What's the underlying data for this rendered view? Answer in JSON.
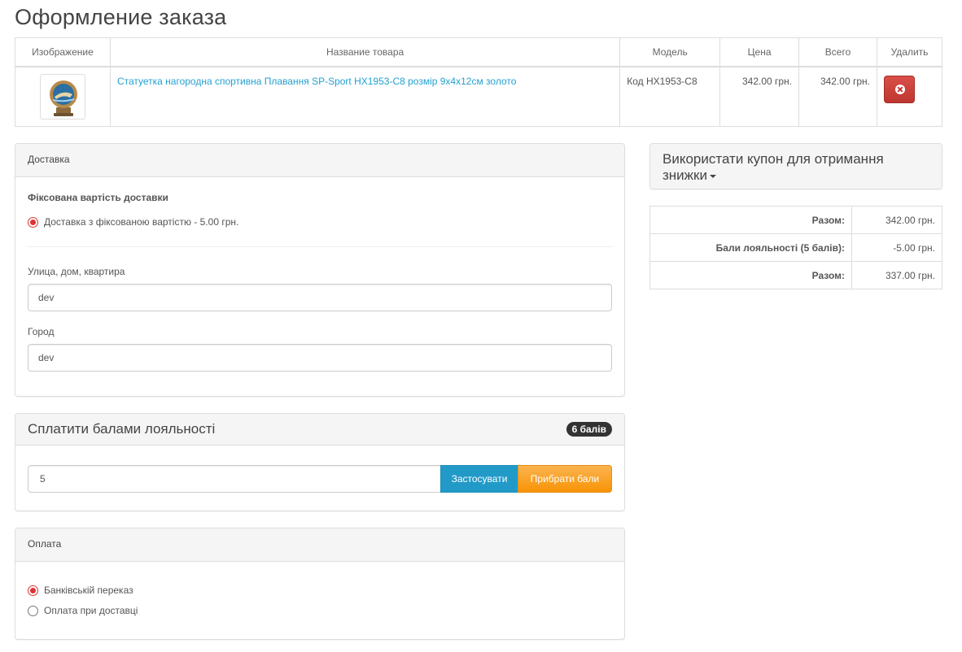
{
  "page": {
    "title": "Оформление заказа"
  },
  "cart": {
    "headers": [
      "Изображение",
      "Название товара",
      "Модель",
      "Цена",
      "Всего",
      "Удалить"
    ],
    "rows": [
      {
        "name": "Статуетка нагородна спортивна Плавання SP-Sport HX1953-C8 розмір 9х4х12см золото",
        "model": "Код HX1953-C8",
        "price": "342.00 грн.",
        "total": "342.00 грн."
      }
    ]
  },
  "delivery": {
    "heading": "Доставка",
    "method_title": "Фіксована вартість доставки",
    "option_label": "Доставка з фіксованою вартістю - 5.00 грн.",
    "street_label": "Улица, дом, квартира",
    "street_value": "dev",
    "city_label": "Город",
    "city_value": "dev"
  },
  "loyalty": {
    "heading": "Сплатити балами лояльності",
    "badge": "6 балів",
    "points_value": "5",
    "apply_label": "Застосувати",
    "remove_label": "Прибрати бали"
  },
  "payment": {
    "heading": "Оплата",
    "options": [
      {
        "label": "Банківській переказ",
        "selected": true
      },
      {
        "label": "Оплата при доставці",
        "selected": false
      }
    ]
  },
  "coupon": {
    "heading": "Використати купон для отримання знижки"
  },
  "totals": [
    {
      "label": "Разом:",
      "value": "342.00 грн."
    },
    {
      "label": "Бали лояльності (5 балів):",
      "value": "-5.00 грн."
    },
    {
      "label": "Разом:",
      "value": "337.00 грн."
    }
  ],
  "colors": {
    "link": "#23a1d1",
    "danger": "#da4f49",
    "primary": "#229ac8",
    "warning": "#f89406",
    "radio_selected": "#dd3333"
  },
  "icons": {
    "delete": "times-circle-icon",
    "caret": "caret-down-icon",
    "product": "swimming-trophy-thumbnail"
  }
}
